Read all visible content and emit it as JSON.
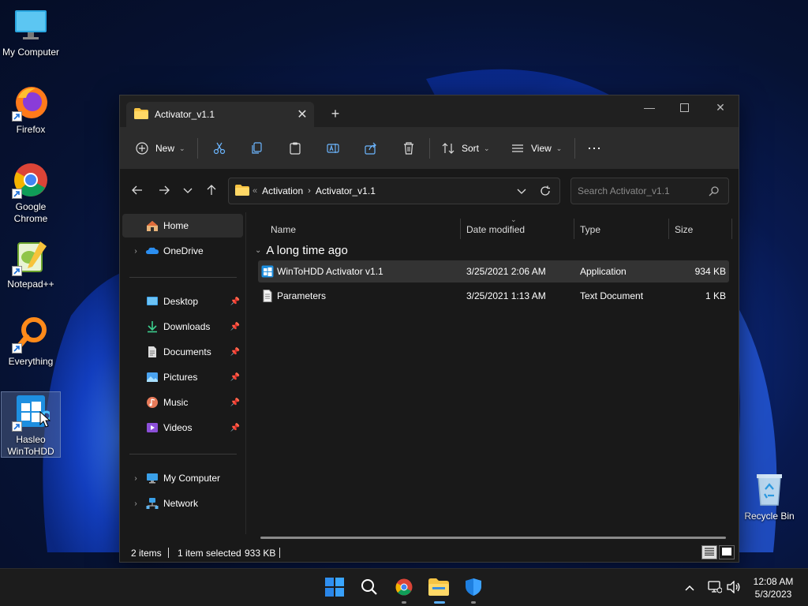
{
  "desktop": {
    "icons": [
      {
        "label": "My Computer"
      },
      {
        "label": "Firefox"
      },
      {
        "label": "Google Chrome"
      },
      {
        "label": "Notepad++"
      },
      {
        "label": "Everything"
      },
      {
        "label": "Hasleo WinToHDD"
      },
      {
        "label": "Recycle Bin"
      }
    ]
  },
  "window": {
    "tab_title": "Activator_v1.1",
    "toolbar": {
      "new_label": "New",
      "sort_label": "Sort",
      "view_label": "View"
    },
    "address": {
      "crumbs": [
        "Activation",
        "Activator_v1.1"
      ]
    },
    "search": {
      "placeholder": "Search Activator_v1.1"
    },
    "nav": {
      "home": "Home",
      "onedrive": "OneDrive",
      "desktop": "Desktop",
      "downloads": "Downloads",
      "documents": "Documents",
      "pictures": "Pictures",
      "music": "Music",
      "videos": "Videos",
      "my_computer": "My Computer",
      "network": "Network"
    },
    "columns": {
      "name": "Name",
      "date": "Date modified",
      "type": "Type",
      "size": "Size"
    },
    "group_label": "A long time ago",
    "files": [
      {
        "name": "WinToHDD Activator v1.1",
        "date": "3/25/2021 2:06 AM",
        "type": "Application",
        "size": "934 KB",
        "selected": true
      },
      {
        "name": "Parameters",
        "date": "3/25/2021 1:13 AM",
        "type": "Text Document",
        "size": "1 KB",
        "selected": false
      }
    ],
    "status": {
      "items": "2 items",
      "selected": "1 item selected",
      "selected_size": "933 KB"
    }
  },
  "taskbar": {
    "time": "12:08 AM",
    "date": "5/3/2023"
  },
  "colors": {
    "accent": "#0078d4",
    "window_bg": "#191919",
    "toolbar_bg": "#2c2c2c",
    "taskbar_bg": "#1c1c1c"
  }
}
